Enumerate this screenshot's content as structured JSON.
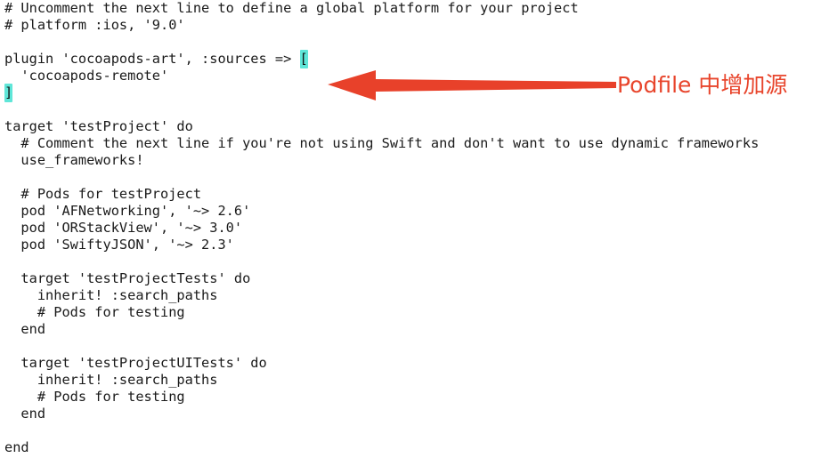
{
  "editor": {
    "background_color": "#ffffff",
    "text_color": "#1a1a1a",
    "highlight_color": "#5fe6d8",
    "font_size_px": 15.3,
    "line_height_px": 19,
    "lines": [
      {
        "n": 1,
        "text": "# Uncomment the next line to define a global platform for your project"
      },
      {
        "n": 2,
        "text": "# platform :ios, '9.0'"
      },
      {
        "n": 3,
        "text": ""
      },
      {
        "n": 4,
        "pre": "plugin 'cocoapods-art', :sources => ",
        "highlight": "[",
        "post": ""
      },
      {
        "n": 5,
        "text": "  'cocoapods-remote'"
      },
      {
        "n": 6,
        "pre": "",
        "highlight": "]",
        "post": ""
      },
      {
        "n": 7,
        "text": ""
      },
      {
        "n": 8,
        "text": "target 'testProject' do"
      },
      {
        "n": 9,
        "text": "  # Comment the next line if you're not using Swift and don't want to use dynamic frameworks"
      },
      {
        "n": 10,
        "text": "  use_frameworks!"
      },
      {
        "n": 11,
        "text": ""
      },
      {
        "n": 12,
        "text": "  # Pods for testProject"
      },
      {
        "n": 13,
        "text": "  pod 'AFNetworking', '~> 2.6'"
      },
      {
        "n": 14,
        "text": "  pod 'ORStackView', '~> 3.0'"
      },
      {
        "n": 15,
        "text": "  pod 'SwiftyJSON', '~> 2.3'"
      },
      {
        "n": 16,
        "text": ""
      },
      {
        "n": 17,
        "text": "  target 'testProjectTests' do"
      },
      {
        "n": 18,
        "text": "    inherit! :search_paths"
      },
      {
        "n": 19,
        "text": "    # Pods for testing"
      },
      {
        "n": 20,
        "text": "  end"
      },
      {
        "n": 21,
        "text": ""
      },
      {
        "n": 22,
        "text": "  target 'testProjectUITests' do"
      },
      {
        "n": 23,
        "text": "    inherit! :search_paths"
      },
      {
        "n": 24,
        "text": "    # Pods for testing"
      },
      {
        "n": 25,
        "text": "  end"
      },
      {
        "n": 26,
        "text": ""
      },
      {
        "n": 27,
        "text": "end"
      }
    ]
  },
  "annotation": {
    "label": "Podfile 中增加源",
    "color": "#e8452c",
    "arrow_color": "#e8412a",
    "arrow_direction": "left"
  }
}
